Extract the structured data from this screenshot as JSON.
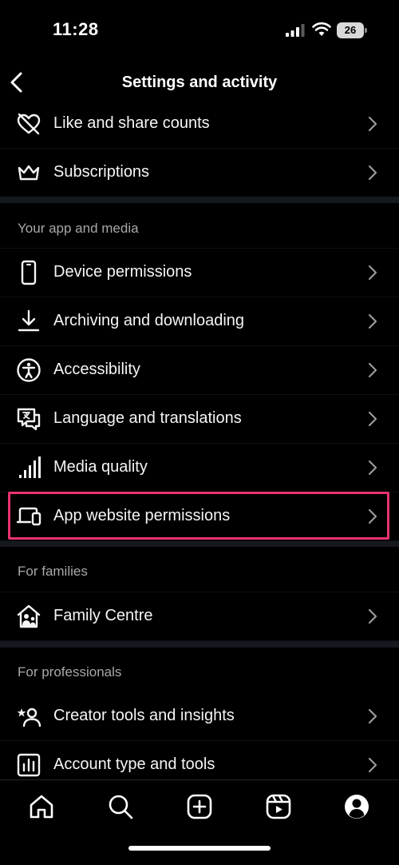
{
  "status_bar": {
    "time": "11:28",
    "battery": "26"
  },
  "header": {
    "title": "Settings and activity"
  },
  "rows": [
    {
      "label": "Like and share counts",
      "icon": "heart-off-icon"
    },
    {
      "label": "Subscriptions",
      "icon": "crown-icon"
    },
    {
      "label": "Device permissions",
      "icon": "phone-icon"
    },
    {
      "label": "Archiving and downloading",
      "icon": "download-icon"
    },
    {
      "label": "Accessibility",
      "icon": "accessibility-icon"
    },
    {
      "label": "Language and translations",
      "icon": "translate-icon"
    },
    {
      "label": "Media quality",
      "icon": "signal-bars-icon"
    },
    {
      "label": "App website permissions",
      "icon": "devices-icon"
    },
    {
      "label": "Family Centre",
      "icon": "family-home-icon"
    },
    {
      "label": "Creator tools and insights",
      "icon": "creator-star-icon"
    },
    {
      "label": "Account type and tools",
      "icon": "chart-icon"
    }
  ],
  "sections": {
    "app_media": "Your app and media",
    "families": "For families",
    "professionals": "For professionals"
  },
  "highlight_color": "#e8336e",
  "bottom_nav": [
    "home-icon",
    "search-icon",
    "create-icon",
    "reels-icon",
    "profile-icon"
  ]
}
